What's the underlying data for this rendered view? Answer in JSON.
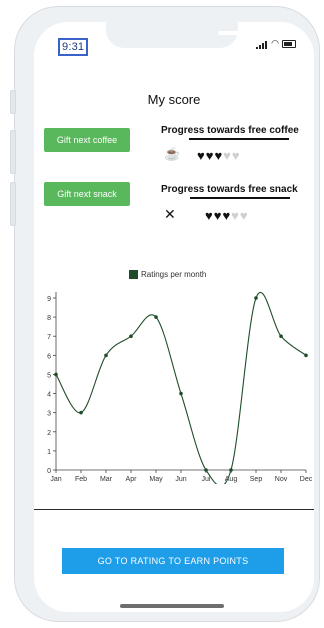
{
  "status": {
    "time": "9:31"
  },
  "page": {
    "title": "My score"
  },
  "rewards": [
    {
      "button_label": "Gift next coffee",
      "progress_label": "Progress towards free coffee",
      "icon": "coffee-cup-icon",
      "filled": 3,
      "total": 5
    },
    {
      "button_label": "Gift next snack",
      "progress_label": "Progress towards free snack",
      "icon": "utensils-icon",
      "filled": 3,
      "total": 5
    }
  ],
  "chart_data": {
    "type": "line",
    "legend": "Ratings per month",
    "categories": [
      "Jan",
      "Feb",
      "Mar",
      "Apr",
      "May",
      "Jun",
      "Jul",
      "Aug",
      "Sep",
      "Nov",
      "Dec"
    ],
    "series": [
      {
        "name": "Ratings per month",
        "values": [
          5,
          3,
          6,
          7,
          8,
          4,
          0,
          0,
          9,
          7,
          6
        ]
      }
    ],
    "yticks": [
      0,
      1,
      2,
      3,
      4,
      5,
      6,
      7,
      8,
      9
    ],
    "ylim": [
      0,
      9
    ],
    "line_color": "#1f4d2b"
  },
  "cta": {
    "label": "GO TO RATING TO EARN POINTS"
  },
  "colors": {
    "green_button": "#59b75c",
    "cta_blue": "#1e9de8"
  }
}
